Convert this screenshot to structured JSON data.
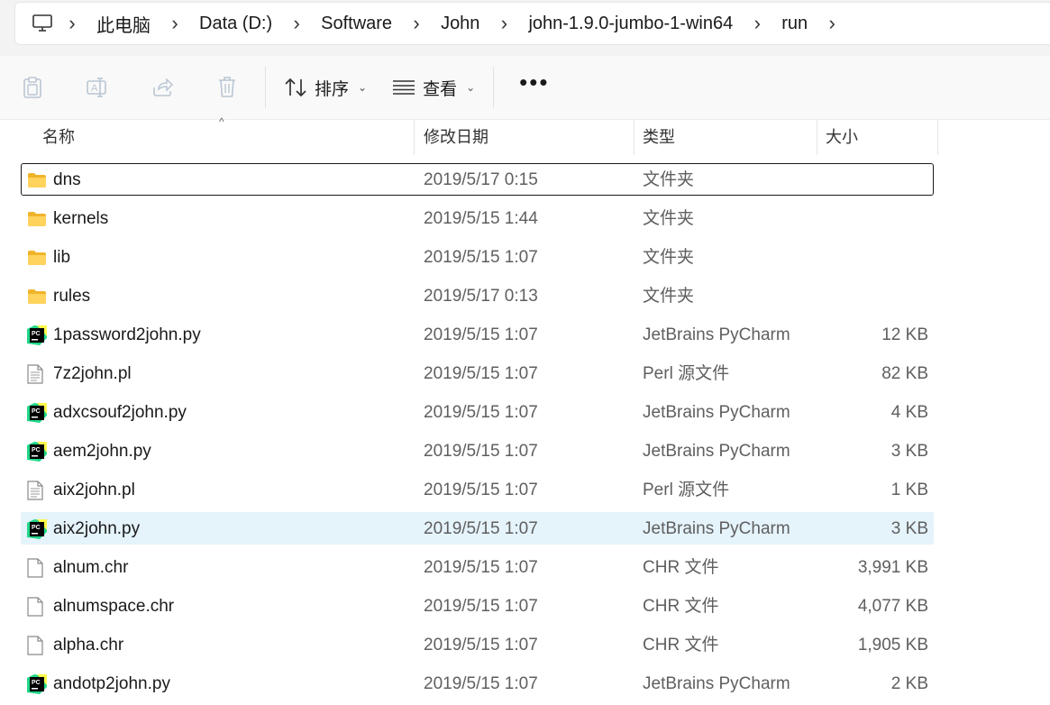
{
  "breadcrumb": {
    "items": [
      "此电脑",
      "Data (D:)",
      "Software",
      "John",
      "john-1.9.0-jumbo-1-win64",
      "run"
    ]
  },
  "toolbar": {
    "sort_label": "排序",
    "view_label": "查看",
    "more_label": "•••"
  },
  "columns": {
    "name": "名称",
    "date": "修改日期",
    "type": "类型",
    "size": "大小"
  },
  "files": [
    {
      "name": "dns",
      "date": "2019/5/17 0:15",
      "type": "文件夹",
      "size": "",
      "icon": "folder-icon",
      "state": "focused"
    },
    {
      "name": "kernels",
      "date": "2019/5/15 1:44",
      "type": "文件夹",
      "size": "",
      "icon": "folder-icon"
    },
    {
      "name": "lib",
      "date": "2019/5/15 1:07",
      "type": "文件夹",
      "size": "",
      "icon": "folder-icon"
    },
    {
      "name": "rules",
      "date": "2019/5/17 0:13",
      "type": "文件夹",
      "size": "",
      "icon": "folder-icon"
    },
    {
      "name": "1password2john.py",
      "date": "2019/5/15 1:07",
      "type": "JetBrains PyCharm",
      "size": "12 KB",
      "icon": "pycharm-icon"
    },
    {
      "name": "7z2john.pl",
      "date": "2019/5/15 1:07",
      "type": "Perl 源文件",
      "size": "82 KB",
      "icon": "text-file-icon"
    },
    {
      "name": "adxcsouf2john.py",
      "date": "2019/5/15 1:07",
      "type": "JetBrains PyCharm",
      "size": "4 KB",
      "icon": "pycharm-icon"
    },
    {
      "name": "aem2john.py",
      "date": "2019/5/15 1:07",
      "type": "JetBrains PyCharm",
      "size": "3 KB",
      "icon": "pycharm-icon"
    },
    {
      "name": "aix2john.pl",
      "date": "2019/5/15 1:07",
      "type": "Perl 源文件",
      "size": "1 KB",
      "icon": "text-file-icon"
    },
    {
      "name": "aix2john.py",
      "date": "2019/5/15 1:07",
      "type": "JetBrains PyCharm",
      "size": "3 KB",
      "icon": "pycharm-icon",
      "state": "selected"
    },
    {
      "name": "alnum.chr",
      "date": "2019/5/15 1:07",
      "type": "CHR 文件",
      "size": "3,991 KB",
      "icon": "blank-file-icon"
    },
    {
      "name": "alnumspace.chr",
      "date": "2019/5/15 1:07",
      "type": "CHR 文件",
      "size": "4,077 KB",
      "icon": "blank-file-icon"
    },
    {
      "name": "alpha.chr",
      "date": "2019/5/15 1:07",
      "type": "CHR 文件",
      "size": "1,905 KB",
      "icon": "blank-file-icon"
    },
    {
      "name": "andotp2john.py",
      "date": "2019/5/15 1:07",
      "type": "JetBrains PyCharm",
      "size": "2 KB",
      "icon": "pycharm-icon"
    }
  ]
}
